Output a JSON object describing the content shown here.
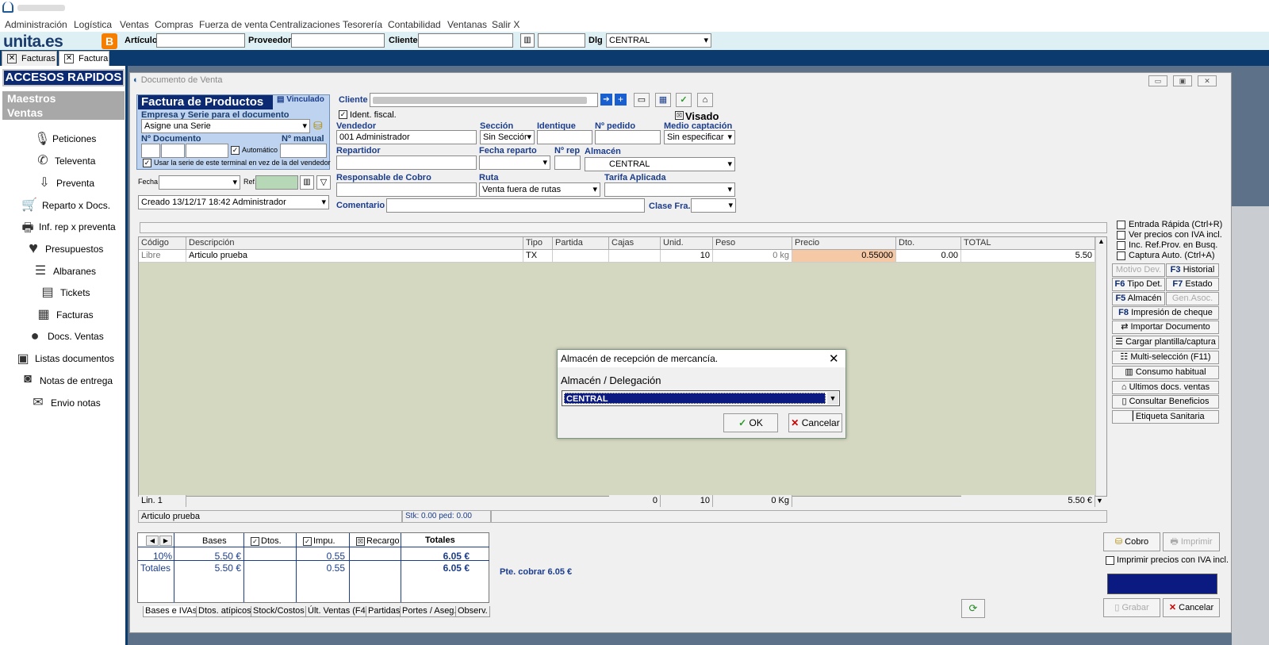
{
  "menu": [
    "Administración",
    "Logística",
    "Ventas",
    "Compras",
    "Fuerza de venta",
    "Centralizaciones",
    "Tesorería",
    "Contabilidad",
    "Ventanas",
    "Salir X"
  ],
  "toolbar": {
    "logo_text": "unita.es",
    "articulo_label": "Artículo",
    "proveedor_label": "Proveedor",
    "cliente_label": "Cliente",
    "dlg_label": "Dlg",
    "dlg_value": "CENTRAL"
  },
  "tabs": [
    "Facturas",
    "Factura"
  ],
  "sidebar": {
    "title": "ACCESOS RAPIDOS",
    "groups": [
      "Maestros",
      "Ventas"
    ],
    "items": [
      "Peticiones",
      "Televenta",
      "Preventa",
      "Reparto x Docs.",
      "Inf. rep x preventa",
      "Presupuestos",
      "Albaranes",
      "Tickets",
      "Facturas",
      "Docs. Ventas",
      "Listas documentos",
      "Notas de entrega",
      "Envio notas"
    ]
  },
  "window": {
    "title": "Documento de Venta"
  },
  "doc": {
    "title": "Factura de Productos",
    "vinculado": "Vinculado",
    "empresa_label": "Empresa y Serie para el documento",
    "serie_value": "Asigne una Serie",
    "ndoc_label": "Nº Documento",
    "nmanual_label": "Nº manual",
    "automatico": "Automático",
    "usar_serie": "Usar la serie de este terminal en vez de la del vendedor",
    "fecha_label": "Fecha",
    "ref_label": "Ref.",
    "creado": "Creado 13/12/17 18:42 Administrador"
  },
  "form": {
    "cliente_label": "Cliente",
    "ident_fiscal": "Ident. fiscal.",
    "visado": "Visado",
    "vendedor_label": "Vendedor",
    "vendedor_value": "001 Administrador",
    "seccion_label": "Sección",
    "seccion_value": "Sin Secciór",
    "identique_label": "Identique",
    "npedido_label": "Nº pedido",
    "medio_label": "Medio captación",
    "medio_value": "Sin especificar",
    "repartidor_label": "Repartidor",
    "fecha_reparto_label": "Fecha reparto",
    "nrep_label": "Nº rep",
    "almacen_label": "Almacén",
    "almacen_value": "CENTRAL",
    "responsable_label": "Responsable de Cobro",
    "ruta_label": "Ruta",
    "ruta_value": "Venta fuera de rutas",
    "tarifa_label": "Tarifa Aplicada",
    "comentario_label": "Comentario",
    "clase_label": "Clase Fra."
  },
  "grid": {
    "headers": [
      "Código",
      "Descripción",
      "Tipo",
      "Partida",
      "Cajas",
      "Unid.",
      "Peso",
      "Precio",
      "Dto.",
      "TOTAL"
    ],
    "row": [
      "Libre",
      "Articulo prueba",
      "TX",
      "",
      "",
      "10",
      "0 kg",
      "0.55000",
      "0.00",
      "5.50"
    ],
    "footer": [
      "Lin. 1",
      "0",
      "10",
      "0 Kg",
      "5.50 €"
    ],
    "status_desc": "Articulo prueba",
    "status_stk": "Stk: 0.00 ped: 0.00"
  },
  "options": [
    "Entrada Rápida (Ctrl+R)",
    "Ver precios con IVA incl.",
    "Inc. Ref.Prov. en Busq.",
    "Captura Auto. (Ctrl+A)"
  ],
  "side_buttons": {
    "motivo_dev": "Motivo Dev.",
    "historial_key": "F3",
    "historial": "Historial",
    "tipo_key": "F6",
    "tipo": "Tipo Det.",
    "estado_key": "F7",
    "estado": "Estado",
    "almacen_key": "F5",
    "almacen": "Almacén",
    "gen_asoc": "Gen.Asoc.",
    "cheque_key": "F8",
    "cheque": "Impresión de cheque",
    "importar": "Importar Documento",
    "cargar": "Cargar plantilla/captura",
    "multi": "Multi-selección (F11)",
    "consumo": "Consumo habitual",
    "ultimos": "Ultimos docs. ventas",
    "beneficios": "Consultar Beneficios",
    "etiqueta": "Etiqueta Sanitaria"
  },
  "totals": {
    "headers": [
      "Bases",
      "Dtos.",
      "Impu.",
      "Recargo",
      "Totales"
    ],
    "row1": [
      "10%",
      "5.50 €",
      "",
      "0.55",
      "",
      "6.05 €"
    ],
    "row2": [
      "Totales",
      "5.50 €",
      "",
      "0.55",
      "",
      "6.05 €"
    ],
    "pte": "Pte. cobrar 6.05 €"
  },
  "bottom_tabs": [
    "Bases e IVAs",
    "Dtos. atípicos",
    "Stock/Costos",
    "Últ. Ventas (F4)",
    "Partidas",
    "Portes / Aseg.",
    "Observ."
  ],
  "actions": {
    "cobro": "Cobro",
    "imprimir": "Imprimir",
    "imprimir_iva": "Imprimir precios con IVA incl.",
    "grabar": "Grabar",
    "cancelar": "Cancelar"
  },
  "dialog": {
    "title": "Almacén de recepción de mercancía.",
    "label": "Almacén / Delegación",
    "value": "CENTRAL",
    "ok": "OK",
    "cancel": "Cancelar"
  }
}
